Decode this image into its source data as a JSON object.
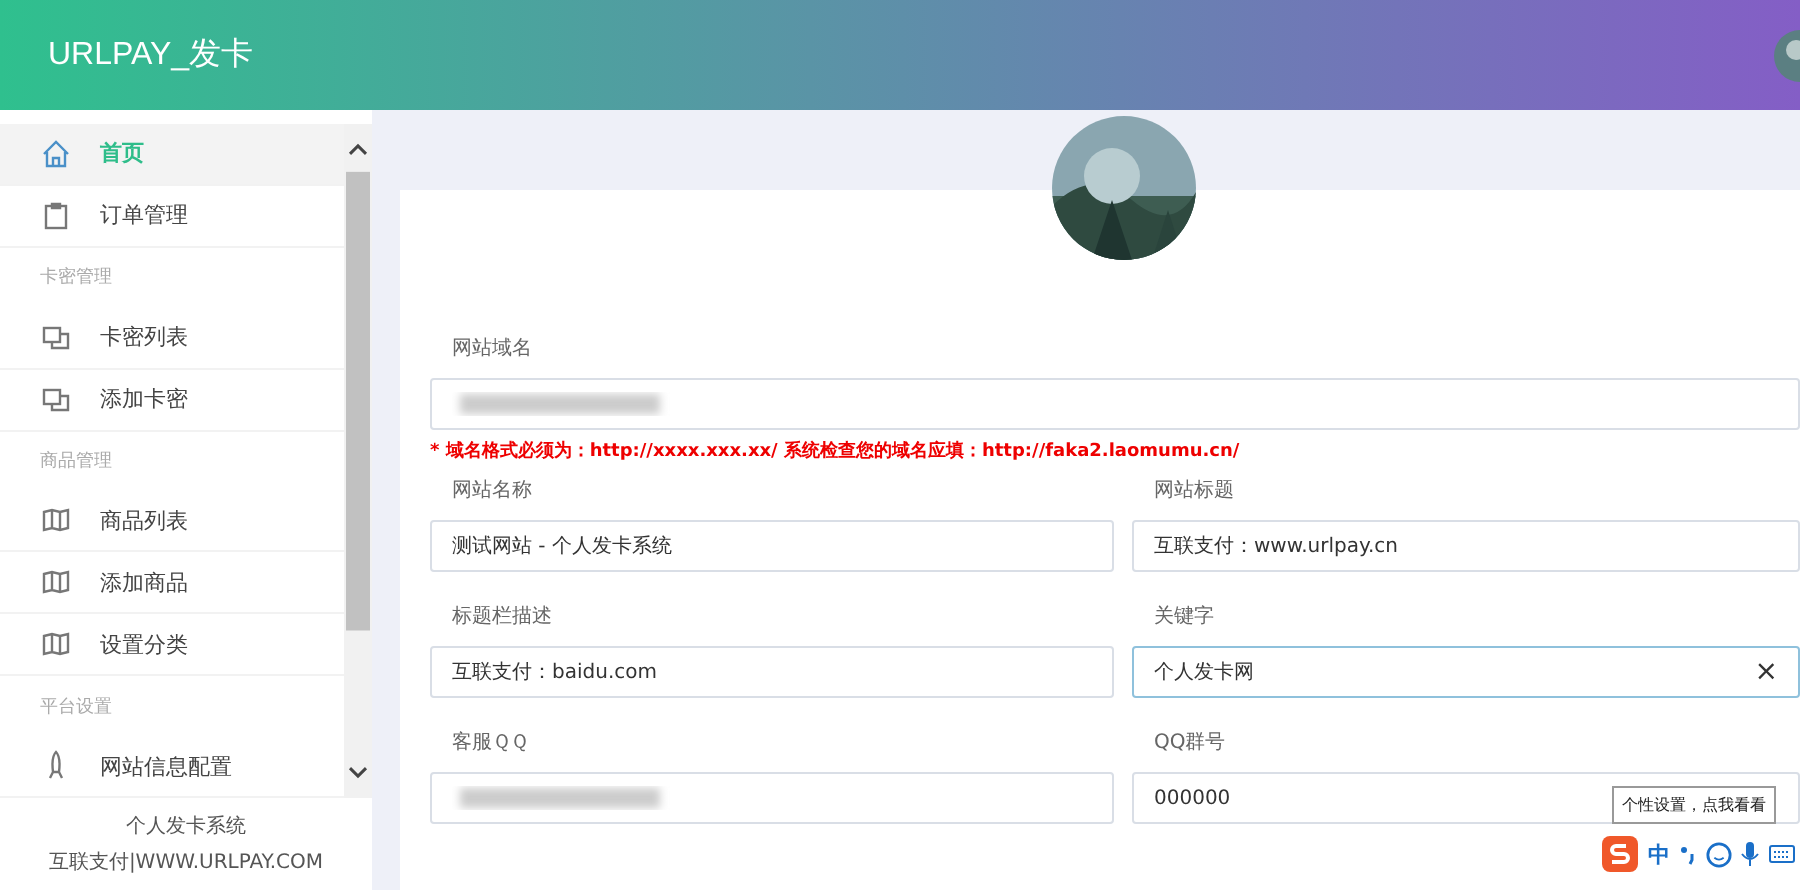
{
  "header": {
    "title": "URLPAY_发卡"
  },
  "sidebar": {
    "items": [
      {
        "kind": "item",
        "label": "首页",
        "selected": true
      },
      {
        "kind": "item",
        "label": "订单管理",
        "selected": false
      },
      {
        "kind": "section",
        "label": "卡密管理"
      },
      {
        "kind": "item",
        "label": "卡密列表",
        "selected": false
      },
      {
        "kind": "item",
        "label": "添加卡密",
        "selected": false
      },
      {
        "kind": "section",
        "label": "商品管理"
      },
      {
        "kind": "item",
        "label": "商品列表",
        "selected": false
      },
      {
        "kind": "item",
        "label": "添加商品",
        "selected": false
      },
      {
        "kind": "item",
        "label": "设置分类",
        "selected": false
      },
      {
        "kind": "section",
        "label": "平台设置"
      },
      {
        "kind": "item",
        "label": "网站信息配置",
        "selected": false
      }
    ],
    "footer": [
      "个人发卡系统",
      "互联支付|WWW.URLPAY.COM"
    ]
  },
  "form": {
    "domain": {
      "label": "网站域名",
      "blurred": true
    },
    "note": "* 域名格式必须为：http://xxxx.xxx.xx/ 系统检查您的域名应填：http://faka2.laomumu.cn/",
    "fields": [
      {
        "label": "网站名称",
        "value": "测试网站 - 个人发卡系统",
        "focused": false,
        "blurred": false
      },
      {
        "label": "网站标题",
        "value": "互联支付：www.urlpay.cn",
        "focused": false,
        "blurred": false
      },
      {
        "label": "标题栏描述",
        "value": "互联支付：baidu.com",
        "focused": false,
        "blurred": false
      },
      {
        "label": "关键字",
        "value": "个人发卡网",
        "focused": true,
        "clear": "×",
        "blurred": false
      },
      {
        "label": "客服ＱＱ",
        "focused": false,
        "blurred": true
      },
      {
        "label": "QQ群号",
        "value": "000000",
        "focused": false,
        "blurred": false
      }
    ]
  },
  "ime_toolbar": {
    "tooltip": "个性设置，点我看看",
    "mode": "中"
  }
}
